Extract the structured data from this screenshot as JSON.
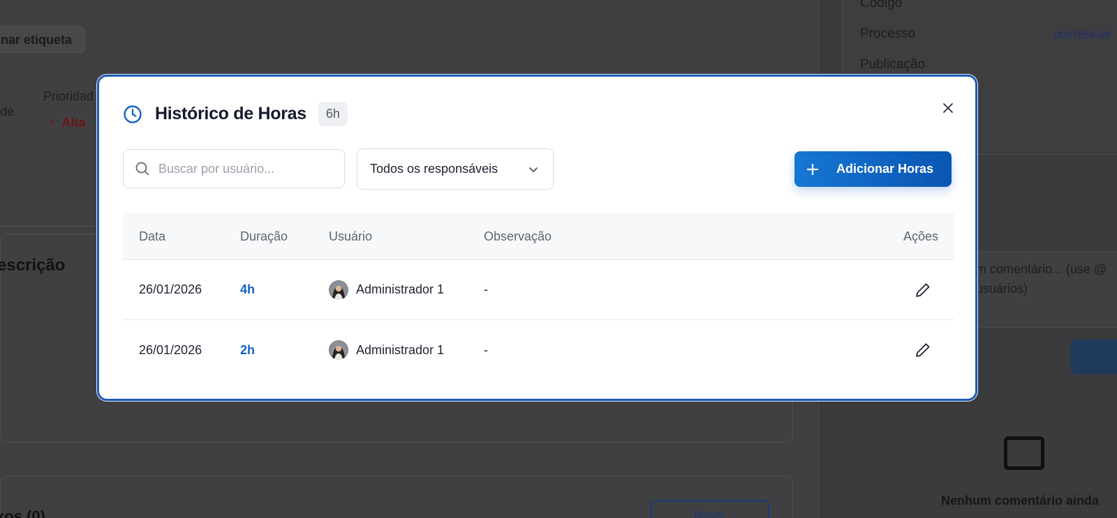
{
  "background": {
    "tag_button": "nar etiqueta",
    "priority_label": "Prioridad",
    "de_fragment": "de",
    "priority_value": "Alta",
    "description_title": "escrição",
    "attachments_title": "xos (0)",
    "new_button": "Novo",
    "side_codigo": "Código",
    "side_processo": "Processo",
    "side_processo_value": "0007658-59",
    "side_publicacao": "Publicação",
    "comment_placeholder_l1": "m comentário... (use @",
    "comment_placeholder_l2": "usuários)",
    "empty_comments": "Nenhum comentário ainda"
  },
  "modal": {
    "title": "Histórico de Horas",
    "total_badge": "6h",
    "search_placeholder": "Buscar por usuário...",
    "filter_selected": "Todos os responsáveis",
    "add_button_label": "Adicionar Horas",
    "accent_color": "#1262c7",
    "columns": {
      "date": "Data",
      "duration": "Duração",
      "user": "Usuário",
      "note": "Observação",
      "actions": "Ações"
    },
    "rows": [
      {
        "date": "26/01/2026",
        "duration": "4h",
        "user": "Administrador 1",
        "note": "-"
      },
      {
        "date": "26/01/2026",
        "duration": "2h",
        "user": "Administrador 1",
        "note": "-"
      }
    ]
  }
}
